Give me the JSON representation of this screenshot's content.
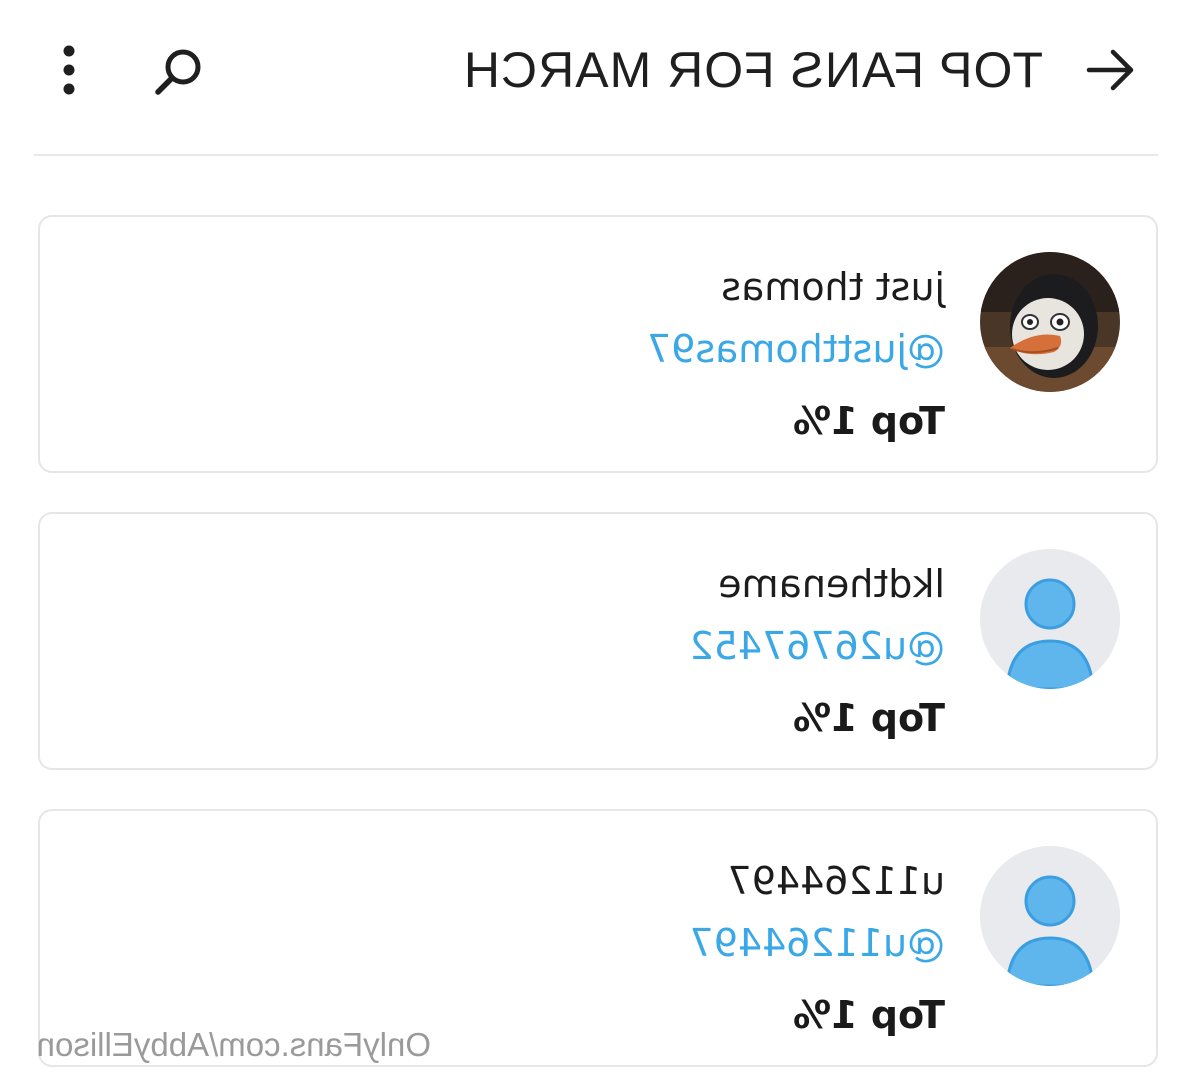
{
  "header": {
    "title": "TOP FANS FOR MARCH",
    "back_icon": "arrow-left-icon",
    "search_icon": "search-icon",
    "more_icon": "more-vertical-icon"
  },
  "fans": [
    {
      "display_name": "just thomas",
      "username": "@justthomas97",
      "rank": "Top 1%",
      "avatar": "cartoon-penguin-avatar"
    },
    {
      "display_name": "lkdthename",
      "username": "@u26767452",
      "rank": "Top 1%",
      "avatar": "default-user-avatar"
    },
    {
      "display_name": "u11264497",
      "username": "@u11264497",
      "rank": "Top 1%",
      "avatar": "default-user-avatar"
    }
  ],
  "watermark": "OnlyFans.com/AbbyEllison",
  "colors": {
    "accent": "#3aa7e6",
    "avatar_placeholder_bg": "#e9eaee",
    "avatar_placeholder_fg": "#5fb6ec",
    "card_border": "#e4e6e8"
  }
}
